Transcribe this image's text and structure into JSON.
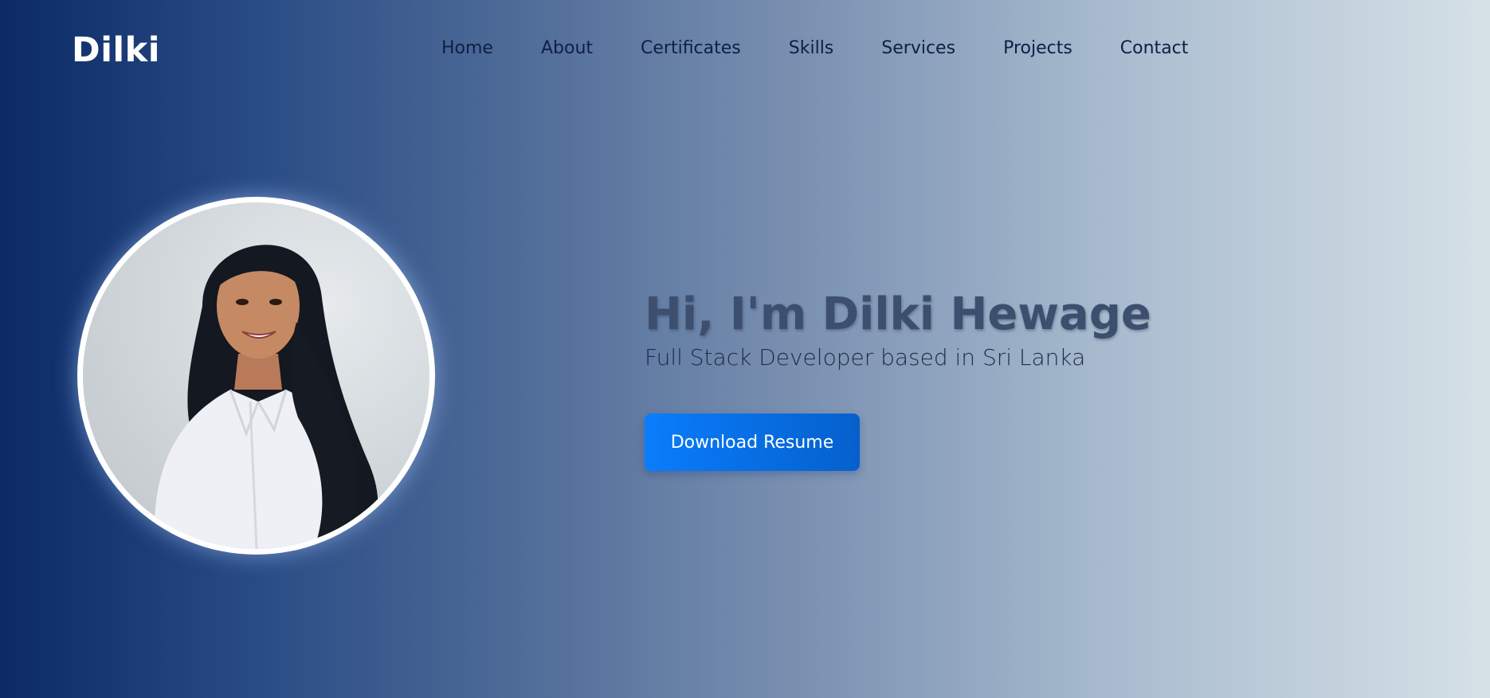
{
  "nav": {
    "brand": "Dilki",
    "links": [
      "Home",
      "About",
      "Certificates",
      "Skills",
      "Services",
      "Projects",
      "Contact"
    ]
  },
  "hero": {
    "title": "Hi, I'm Dilki Hewage",
    "subtitle": "Full Stack Developer based in Sri Lanka",
    "button_label": "Download Resume"
  },
  "colors": {
    "accent": "#0a7dfc",
    "nav_text": "#0f1f45",
    "brand_text": "#ffffff",
    "title_text": "#3d4f6e"
  },
  "icons": {
    "avatar": "profile-photo"
  }
}
